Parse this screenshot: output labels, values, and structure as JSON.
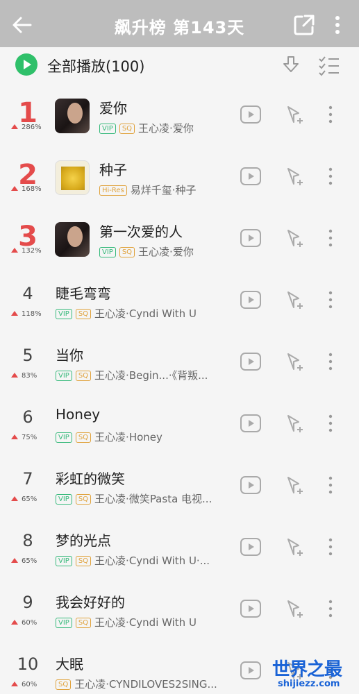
{
  "header": {
    "title": "飙升榜 第143天",
    "back_icon": "arrow-left-icon",
    "share_icon": "share-external-icon",
    "more_icon": "more-vertical-icon"
  },
  "play_all": {
    "label": "全部播放(100)",
    "accent": "#2fc06a"
  },
  "colors": {
    "rank_top": "#e44b4b",
    "vip": "#35b97a",
    "sq": "#e0a23b"
  },
  "songs": [
    {
      "rank": "1",
      "change": "286%",
      "title": "爱你",
      "tags": [
        "VIP",
        "SQ"
      ],
      "meta": "王心凌·爱你",
      "cover": "dark"
    },
    {
      "rank": "2",
      "change": "168%",
      "title": "种子",
      "tags": [
        "Hi-Res"
      ],
      "meta": "易烊千玺·种子",
      "cover": "gold"
    },
    {
      "rank": "3",
      "change": "132%",
      "title": "第一次爱的人",
      "tags": [
        "VIP",
        "SQ"
      ],
      "meta": "王心凌·爱你",
      "cover": "dark"
    },
    {
      "rank": "4",
      "change": "118%",
      "title": "睫毛弯弯",
      "tags": [
        "VIP",
        "SQ"
      ],
      "meta": "王心凌·Cyndi With U"
    },
    {
      "rank": "5",
      "change": "83%",
      "title": "当你",
      "tags": [
        "VIP",
        "SQ"
      ],
      "meta": "王心凌·Begin...·《背叛..."
    },
    {
      "rank": "6",
      "change": "75%",
      "title": "Honey",
      "tags": [
        "VIP",
        "SQ"
      ],
      "meta": "王心凌·Honey"
    },
    {
      "rank": "7",
      "change": "65%",
      "title": "彩虹的微笑",
      "tags": [
        "VIP",
        "SQ"
      ],
      "meta": "王心凌·微笑Pasta 电视..."
    },
    {
      "rank": "8",
      "change": "65%",
      "title": "梦的光点",
      "tags": [
        "VIP",
        "SQ"
      ],
      "meta": "王心凌·Cyndi With U·..."
    },
    {
      "rank": "9",
      "change": "60%",
      "title": "我会好好的",
      "tags": [
        "VIP",
        "SQ"
      ],
      "meta": "王心凌·Cyndi With U"
    },
    {
      "rank": "10",
      "change": "60%",
      "title": "大眠",
      "tags": [
        "SQ"
      ],
      "meta": "王心凌·CYNDILOVES2SING..."
    }
  ],
  "watermark": {
    "line1": "世界之最",
    "line2": "shijiezz.com"
  }
}
